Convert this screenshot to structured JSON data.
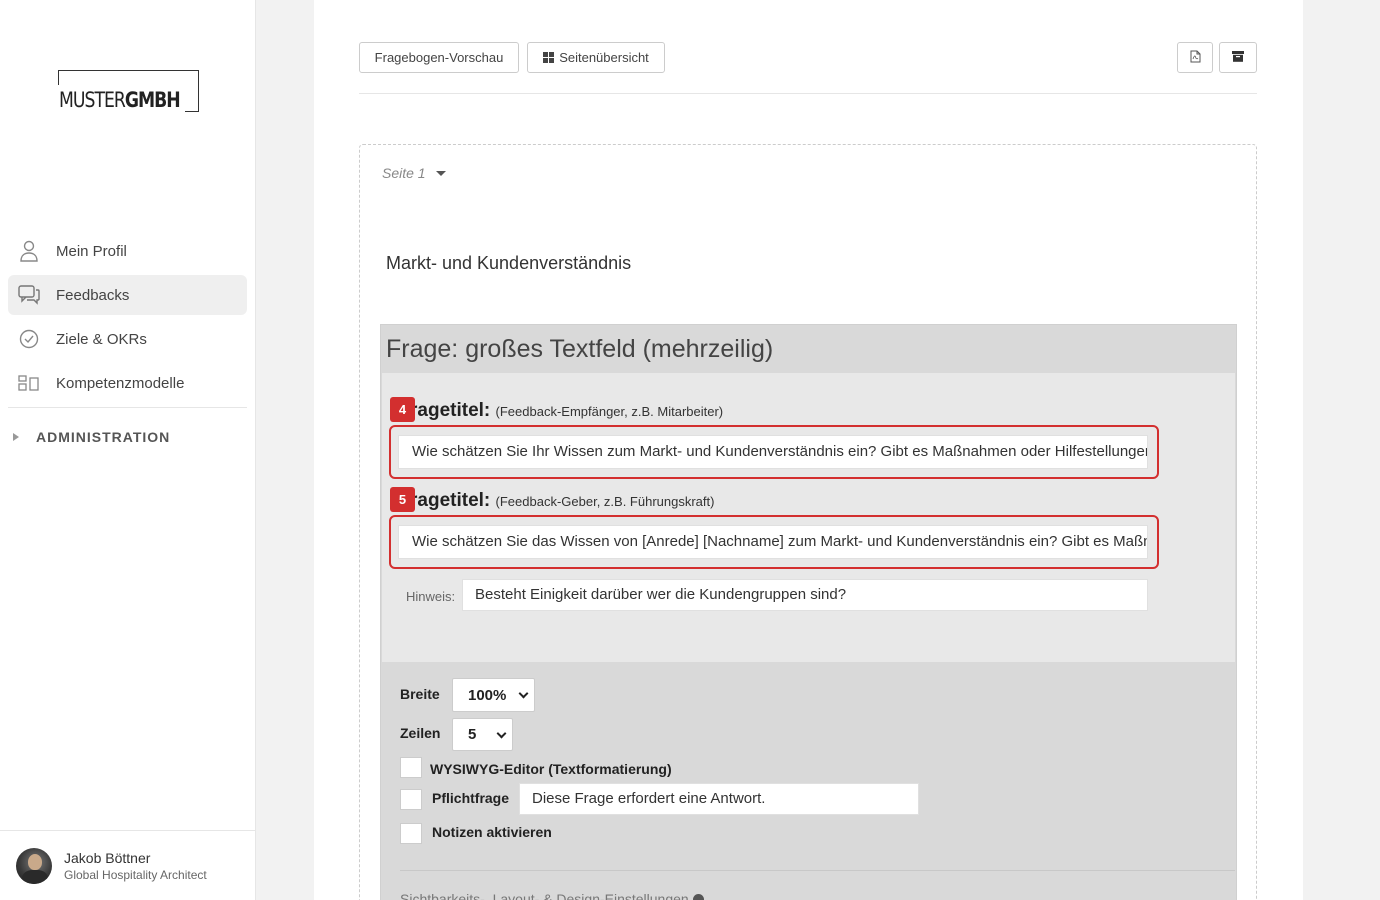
{
  "brand": {
    "logo_part1": "MUSTER",
    "logo_part2": "GMBH"
  },
  "sidebar": {
    "items": [
      {
        "label": "Mein Profil",
        "icon": "user-icon"
      },
      {
        "label": "Feedbacks",
        "icon": "chat-bubbles-icon",
        "active": true
      },
      {
        "label": "Ziele & OKRs",
        "icon": "check-circle-icon"
      },
      {
        "label": "Kompetenzmodelle",
        "icon": "competence-model-icon"
      }
    ],
    "admin_label": "ADMINISTRATION"
  },
  "user": {
    "name": "Jakob Böttner",
    "role": "Global Hospitality Architect"
  },
  "toolbar": {
    "preview_label": "Fragebogen-Vorschau",
    "overview_label": "Seitenübersicht"
  },
  "page": {
    "selector_label": "Seite 1",
    "section_title": "Markt- und Kundenverständnis"
  },
  "question": {
    "header": "Frage: großes Textfeld (mehrzeilig)",
    "title_label": "ragetitel:",
    "recipient_hint": "(Feedback-Empfänger, z.B. Mitarbeiter)",
    "giver_hint": "(Feedback-Geber, z.B. Führungskraft)",
    "recipient_badge": "4",
    "giver_badge": "5",
    "recipient_text": "Wie schätzen Sie Ihr Wissen zum Markt- und Kundenverständnis ein? Gibt es Maßnahmen oder Hilfestellungen",
    "giver_text": "Wie schätzen Sie das Wissen von [Anrede] [Nachname] zum Markt- und Kundenverständnis ein? Gibt es Maßnahmen",
    "hint_label": "Hinweis:",
    "hint_value": "Besteht Einigkeit darüber wer die Kundengruppen sind?"
  },
  "options": {
    "width_label": "Breite",
    "width_value": "100%",
    "rows_label": "Zeilen",
    "rows_value": "5",
    "wysiwyg_label": "WYSIWYG-Editor (Textformatierung)",
    "required_label": "Pflichtfrage",
    "required_message": "Diese Frage erfordert eine Antwort.",
    "notes_label": "Notizen aktivieren",
    "visibility_label": "Sichtbarkeits-, Layout- & Design-Einstellungen"
  },
  "colors": {
    "highlight": "#d32f2f",
    "card": "#d9d9d9"
  }
}
